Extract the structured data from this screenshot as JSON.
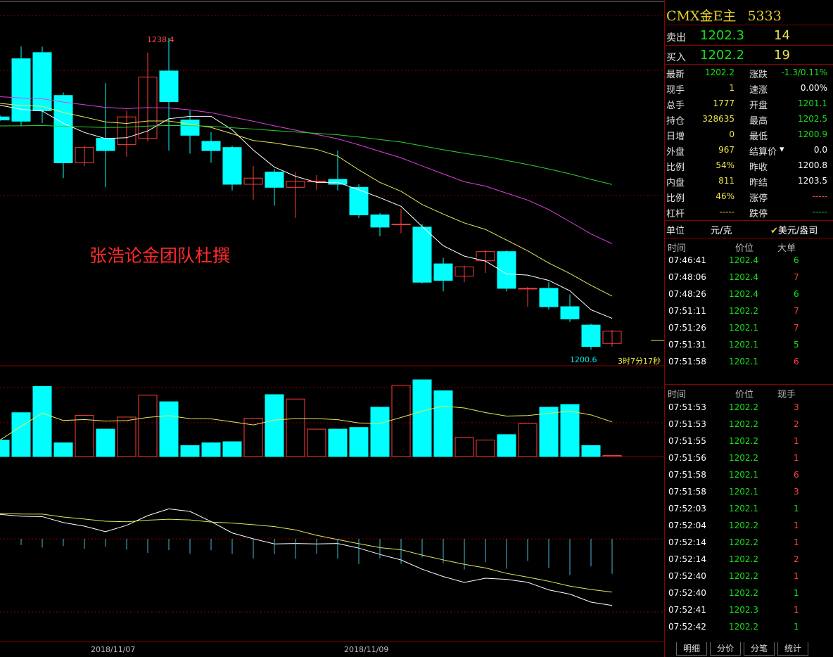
{
  "chart": {
    "high_label": "1238.4",
    "low_label": "1200.6",
    "countdown": "3时7分17秒",
    "watermark": "张浩论金团队杜撰",
    "dates": [
      "2018/11/07",
      "2018/11/09"
    ]
  },
  "chart_data": {
    "type": "candlestick",
    "candles": [
      {
        "o": 1225.5,
        "c": 1225.0,
        "h": 1225.8,
        "l": 1224.8
      },
      {
        "o": 1235.0,
        "c": 1224.8,
        "h": 1237.0,
        "l": 1224.0
      },
      {
        "o": 1236.0,
        "c": 1226.5,
        "h": 1237.0,
        "l": 1224.5
      },
      {
        "o": 1229.0,
        "c": 1218.0,
        "h": 1229.5,
        "l": 1215.5
      },
      {
        "o": 1218.0,
        "c": 1220.5,
        "h": 1220.8,
        "l": 1217.5
      },
      {
        "o": 1222.0,
        "c": 1220.0,
        "h": 1231.0,
        "l": 1214.0
      },
      {
        "o": 1221.0,
        "c": 1225.5,
        "h": 1226.5,
        "l": 1219.0
      },
      {
        "o": 1222.0,
        "c": 1232.0,
        "h": 1236.0,
        "l": 1221.5
      },
      {
        "o": 1233.0,
        "c": 1228.0,
        "h": 1238.4,
        "l": 1220.0
      },
      {
        "o": 1225.0,
        "c": 1222.5,
        "h": 1226.5,
        "l": 1219.5
      },
      {
        "o": 1221.5,
        "c": 1220.0,
        "h": 1223.0,
        "l": 1218.0
      },
      {
        "o": 1220.5,
        "c": 1214.5,
        "h": 1220.8,
        "l": 1213.5
      },
      {
        "o": 1214.5,
        "c": 1215.5,
        "h": 1217.5,
        "l": 1212.0
      },
      {
        "o": 1216.5,
        "c": 1214.0,
        "h": 1217.0,
        "l": 1211.0
      },
      {
        "o": 1214.0,
        "c": 1215.0,
        "h": 1216.5,
        "l": 1209.0
      },
      {
        "o": 1215.0,
        "c": 1215.0,
        "h": 1216.0,
        "l": 1213.5
      },
      {
        "o": 1215.3,
        "c": 1214.5,
        "h": 1220.0,
        "l": 1213.5
      },
      {
        "o": 1214.0,
        "c": 1209.5,
        "h": 1214.5,
        "l": 1209.0
      },
      {
        "o": 1209.5,
        "c": 1207.5,
        "h": 1209.8,
        "l": 1206.0
      },
      {
        "o": 1208.0,
        "c": 1208.0,
        "h": 1210.5,
        "l": 1206.5
      },
      {
        "o": 1207.5,
        "c": 1198.5,
        "h": 1208.0,
        "l": 1198.3
      },
      {
        "o": 1201.5,
        "c": 1198.8,
        "h": 1202.5,
        "l": 1197.0
      },
      {
        "o": 1199.5,
        "c": 1201.0,
        "h": 1201.2,
        "l": 1198.5
      },
      {
        "o": 1202.0,
        "c": 1203.5,
        "h": 1203.8,
        "l": 1200.0
      },
      {
        "o": 1203.5,
        "c": 1197.5,
        "h": 1203.7,
        "l": 1197.0
      },
      {
        "o": 1197.5,
        "c": 1197.5,
        "h": 1197.7,
        "l": 1194.5
      },
      {
        "o": 1197.5,
        "c": 1194.5,
        "h": 1198.5,
        "l": 1194.0
      },
      {
        "o": 1194.5,
        "c": 1192.5,
        "h": 1196.5,
        "l": 1192.0
      },
      {
        "o": 1191.5,
        "c": 1188.0,
        "h": 1191.7,
        "l": 1187.5
      },
      {
        "o": 1188.5,
        "c": 1190.5,
        "h": 1190.7,
        "l": 1188.0
      }
    ],
    "volumes": [
      30,
      80,
      128,
      25,
      75,
      50,
      72,
      112,
      100,
      20,
      25,
      27,
      70,
      113,
      105,
      50,
      50,
      53,
      90,
      130,
      140,
      120,
      35,
      30,
      40,
      60,
      90,
      95,
      20,
      2
    ]
  },
  "header": {
    "title": "CMX金E主",
    "code": "5333"
  },
  "quotes": {
    "sell": {
      "label": "卖出",
      "price": "1202.3",
      "vol": "14"
    },
    "buy": {
      "label": "买入",
      "price": "1202.2",
      "vol": "19"
    }
  },
  "stats": [
    {
      "l1": "最新",
      "v1": "1202.2",
      "c1": "g",
      "l2": "涨跌",
      "v2": "-1.3/0.11%",
      "c2": "g"
    },
    {
      "l1": "现手",
      "v1": "1",
      "c1": "y",
      "l2": "速涨",
      "v2": "0.00%",
      "c2": "w"
    },
    {
      "l1": "总手",
      "v1": "1777",
      "c1": "y",
      "l2": "开盘",
      "v2": "1201.1",
      "c2": "g"
    },
    {
      "l1": "持仓",
      "v1": "328635",
      "c1": "y",
      "l2": "最高",
      "v2": "1202.5",
      "c2": "g"
    },
    {
      "l1": "日增",
      "v1": "0",
      "c1": "y",
      "l2": "最低",
      "v2": "1200.9",
      "c2": "g"
    },
    {
      "l1": "外盘",
      "v1": "967",
      "c1": "y",
      "l2": "结算价",
      "v2": "0.0",
      "c2": "w"
    },
    {
      "l1": "比例",
      "v1": "54%",
      "c1": "y",
      "l2": "昨收",
      "v2": "1200.8",
      "c2": "w"
    },
    {
      "l1": "内盘",
      "v1": "811",
      "c1": "y",
      "l2": "昨结",
      "v2": "1203.5",
      "c2": "w"
    },
    {
      "l1": "比例",
      "v1": "46%",
      "c1": "y",
      "l2": "涨停",
      "v2": "-----",
      "c2": "r"
    },
    {
      "l1": "杠杆",
      "v1": "-----",
      "c1": "y",
      "l2": "跌停",
      "v2": "-----",
      "c2": "g"
    }
  ],
  "unit": {
    "label": "单位",
    "value": "元/克",
    "toggle": "美元/盎司"
  },
  "big_orders": {
    "headers": [
      "时间",
      "价位",
      "大单"
    ],
    "rows": [
      {
        "t": "07:46:41",
        "p": "1202.4",
        "v": "6",
        "vc": "g"
      },
      {
        "t": "07:48:06",
        "p": "1202.4",
        "v": "7",
        "vc": "r"
      },
      {
        "t": "07:48:26",
        "p": "1202.4",
        "v": "6",
        "vc": "g"
      },
      {
        "t": "07:51:11",
        "p": "1202.2",
        "v": "7",
        "vc": "r"
      },
      {
        "t": "07:51:26",
        "p": "1202.1",
        "v": "7",
        "vc": "r"
      },
      {
        "t": "07:51:31",
        "p": "1202.1",
        "v": "5",
        "vc": "g"
      },
      {
        "t": "07:51:58",
        "p": "1202.1",
        "v": "6",
        "vc": "r"
      }
    ]
  },
  "ticks": {
    "headers": [
      "时间",
      "价位",
      "现手"
    ],
    "rows": [
      {
        "t": "07:51:53",
        "p": "1202.2",
        "v": "3",
        "vc": "r"
      },
      {
        "t": "07:51:53",
        "p": "1202.2",
        "v": "2",
        "vc": "r"
      },
      {
        "t": "07:51:55",
        "p": "1202.2",
        "v": "1",
        "vc": "r"
      },
      {
        "t": "07:51:56",
        "p": "1202.2",
        "v": "1",
        "vc": "r"
      },
      {
        "t": "07:51:58",
        "p": "1202.1",
        "v": "6",
        "vc": "r"
      },
      {
        "t": "07:51:58",
        "p": "1202.1",
        "v": "3",
        "vc": "r"
      },
      {
        "t": "07:52:03",
        "p": "1202.1",
        "v": "1",
        "vc": "g"
      },
      {
        "t": "07:52:04",
        "p": "1202.2",
        "v": "1",
        "vc": "r"
      },
      {
        "t": "07:52:14",
        "p": "1202.2",
        "v": "1",
        "vc": "r"
      },
      {
        "t": "07:52:14",
        "p": "1202.2",
        "v": "2",
        "vc": "r"
      },
      {
        "t": "07:52:40",
        "p": "1202.2",
        "v": "1",
        "vc": "r"
      },
      {
        "t": "07:52:40",
        "p": "1202.2",
        "v": "1",
        "vc": "g"
      },
      {
        "t": "07:52:41",
        "p": "1202.3",
        "v": "1",
        "vc": "r"
      },
      {
        "t": "07:52:42",
        "p": "1202.2",
        "v": "1",
        "vc": "g"
      }
    ]
  },
  "tabs": [
    "明细",
    "分价",
    "分笔",
    "统计"
  ],
  "colors": {
    "up": "#ff3c3c",
    "down": "#00ffff",
    "grid": "#8a0000",
    "ma5": "#ffffff",
    "ma10": "#e8e85a",
    "ma20": "#e040e0",
    "ma60": "#2fd02f"
  }
}
